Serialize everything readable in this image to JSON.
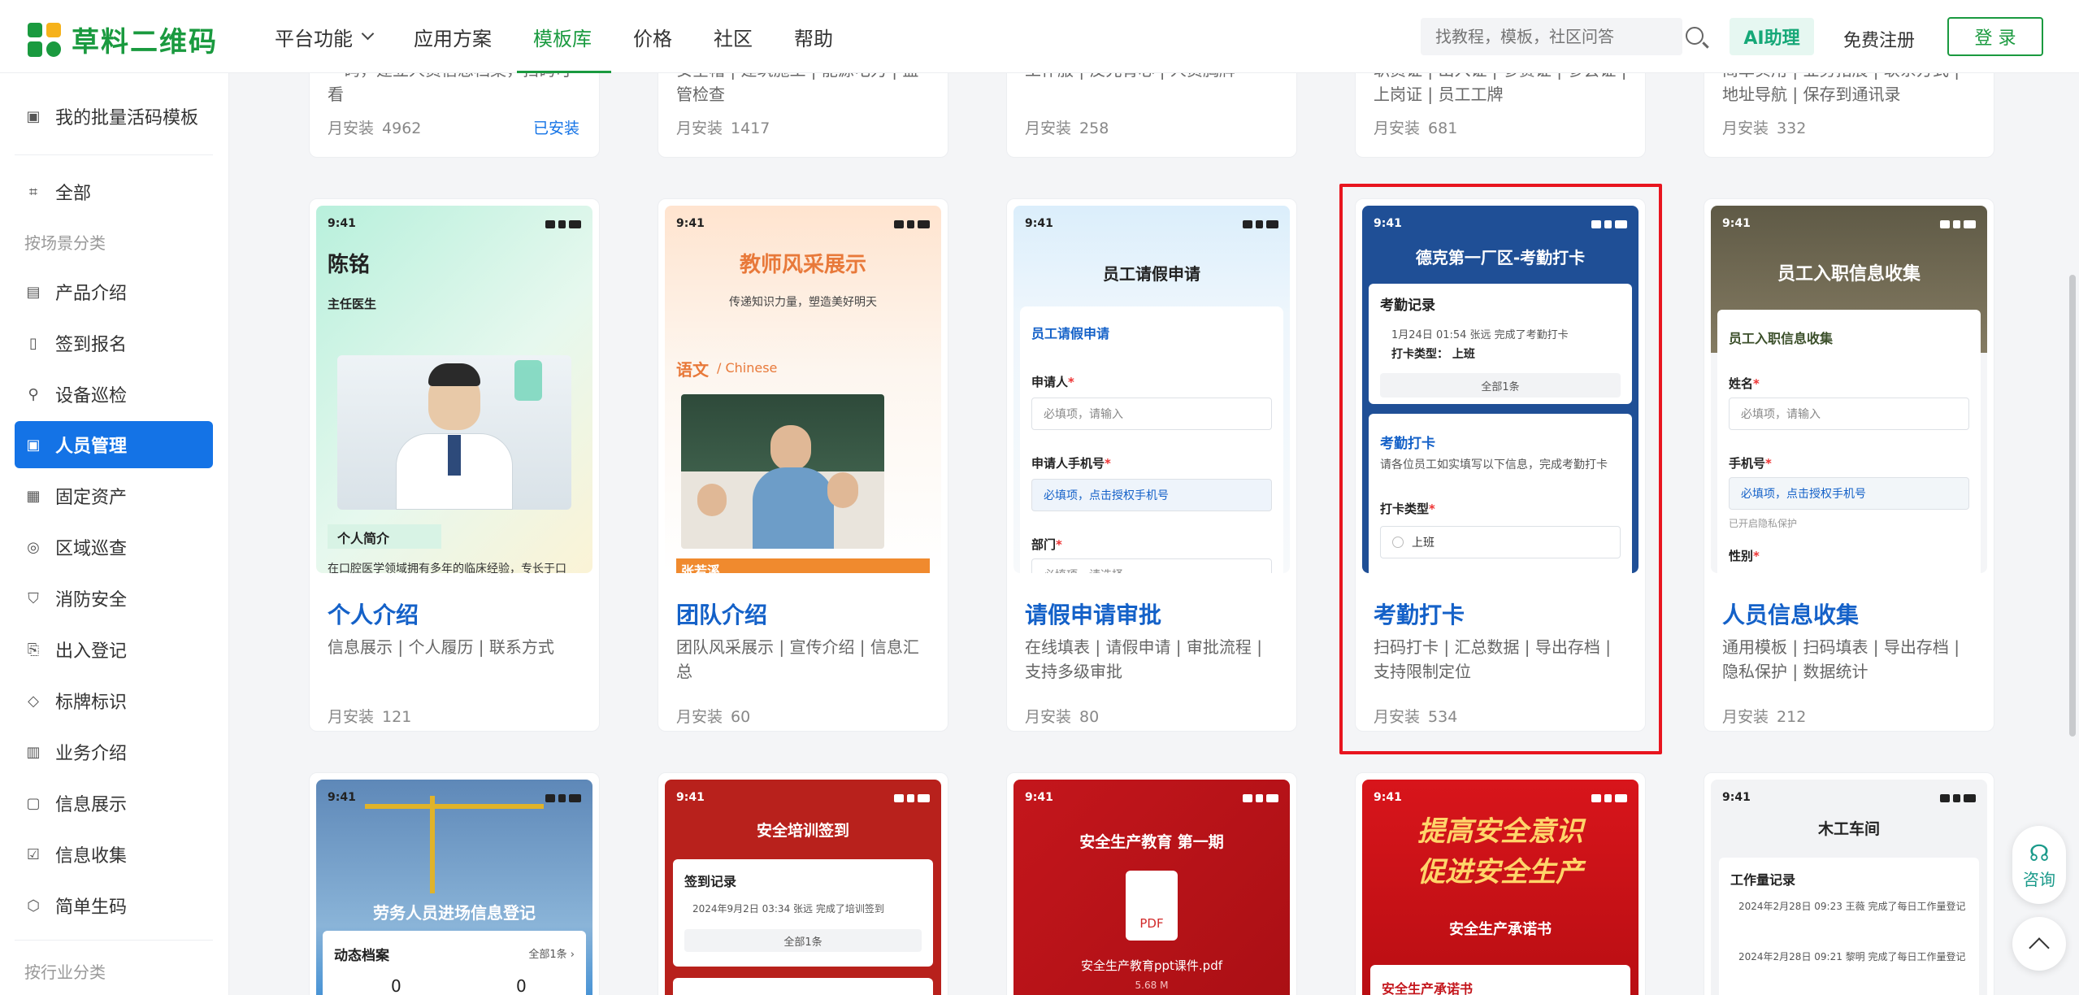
{
  "brand": {
    "name": "草料二维码",
    "colors": {
      "green": "#1a9a3f",
      "blue": "#1473e6",
      "highlight": "#e8151f"
    }
  },
  "nav": {
    "items": [
      {
        "label": "平台功能",
        "dropdown": true
      },
      {
        "label": "应用方案"
      },
      {
        "label": "模板库",
        "active": true
      },
      {
        "label": "价格"
      },
      {
        "label": "社区"
      },
      {
        "label": "帮助"
      }
    ]
  },
  "header": {
    "search_placeholder": "找教程，模板，社区问答",
    "ai_label": "AI助理",
    "register_label": "免费注册",
    "login_label": "登 录"
  },
  "sidebar": {
    "my_templates": "我的批量活码模板",
    "all": "全部",
    "scene_category": "按场景分类",
    "industry_category": "按行业分类",
    "items": [
      {
        "label": "产品介绍",
        "icon": "box-icon"
      },
      {
        "label": "签到报名",
        "icon": "signin-icon"
      },
      {
        "label": "设备巡检",
        "icon": "inspect-icon"
      },
      {
        "label": "人员管理",
        "icon": "person-icon",
        "active": true
      },
      {
        "label": "固定资产",
        "icon": "asset-icon"
      },
      {
        "label": "区域巡查",
        "icon": "location-icon"
      },
      {
        "label": "消防安全",
        "icon": "fire-icon"
      },
      {
        "label": "出入登记",
        "icon": "exit-icon"
      },
      {
        "label": "标牌标识",
        "icon": "tag-icon"
      },
      {
        "label": "业务介绍",
        "icon": "business-icon"
      },
      {
        "label": "信息展示",
        "icon": "display-icon"
      },
      {
        "label": "信息收集",
        "icon": "collect-icon"
      },
      {
        "label": "简单生码",
        "icon": "cube-icon"
      }
    ]
  },
  "top_cards": [
    {
      "tags": "一码，建立人员信息档案，扫码可看",
      "installs_label": "月安装",
      "installs": "4962",
      "status": "已安装"
    },
    {
      "tags": "安全帽 | 建筑施工 | 能源电力 | 监管检查",
      "installs_label": "月安装",
      "installs": "1417"
    },
    {
      "tags": "工作服 | 反光背心 | 人员胸牌",
      "installs_label": "月安装",
      "installs": "258"
    },
    {
      "tags": "职员证 | 出入证 | 参赛证 | 参会证 | 上岗证 | 员工工牌",
      "installs_label": "月安装",
      "installs": "681"
    },
    {
      "tags": "简单实用 | 业务拓展 | 联系方式 | 地址导航 | 保存到通讯录",
      "installs_label": "月安装",
      "installs": "332"
    }
  ],
  "cards": [
    {
      "title": "个人介绍",
      "tags": "信息展示 | 个人履历 | 联系方式",
      "installs_label": "月安装",
      "installs": "121",
      "preview": {
        "time": "9:41",
        "name": "陈铭",
        "role": "主任医生",
        "section": "个人简介",
        "desc": "在口腔医学领域拥有多年的临床经验，专长于口"
      }
    },
    {
      "title": "团队介绍",
      "tags": "团队风采展示 | 宣传介绍 | 信息汇总",
      "installs_label": "月安装",
      "installs": "60",
      "preview": {
        "time": "9:41",
        "heading": "教师风采展示",
        "sub": "传递知识力量，塑造美好明天",
        "subject": "语文",
        "subject_en": "/ Chinese",
        "teacher": "张若溪"
      }
    },
    {
      "title": "请假申请审批",
      "tags": "在线填表 | 请假申请 | 审批流程 | 支持多级审批",
      "installs_label": "月安装",
      "installs": "80",
      "preview": {
        "time": "9:41",
        "heading": "员工请假申请",
        "form_title": "员工请假申请",
        "f1": "申请人",
        "f1_ph": "必填项，请输入",
        "f2": "申请人手机号",
        "f2_ph": "必填项，点击授权手机号",
        "f3": "部门",
        "f3_ph": "必填项，请选择"
      }
    },
    {
      "title": "考勤打卡",
      "tags": "扫码打卡 | 汇总数据 | 导出存档 | 支持限制定位",
      "installs_label": "月安装",
      "installs": "534",
      "preview": {
        "time": "9:41",
        "heading": "德克第一厂区-考勤打卡",
        "rec_title": "考勤记录",
        "rec_line": "1月24日 01:54 张远 完成了考勤打卡",
        "rec_type": "打卡类型：  上班",
        "rec_all": "全部1条",
        "punch_title": "考勤打卡",
        "punch_desc": "请各位员工如实填写以下信息，完成考勤打卡",
        "punch_type": "打卡类型",
        "punch_opt": "上班"
      }
    },
    {
      "title": "人员信息收集",
      "tags": "通用模板 | 扫码填表 | 导出存档 | 隐私保护 | 数据统计",
      "installs_label": "月安装",
      "installs": "212",
      "preview": {
        "time": "9:41",
        "heading": "员工入职信息收集",
        "form_title": "员工入职信息收集",
        "f1": "姓名",
        "f1_ph": "必填项，请输入",
        "f2": "手机号",
        "f2_ph": "必填项，点击授权手机号",
        "f2_note": "已开启隐私保护",
        "f3": "性别"
      }
    }
  ],
  "bottom_cards": [
    {
      "time": "9:41",
      "heading": "劳务人员进场信息登记",
      "panel": "动态档案",
      "panel_link": "全部1条 ›",
      "n1": "0",
      "n2": "0"
    },
    {
      "time": "9:41",
      "heading": "安全培训签到",
      "rec": "签到记录",
      "line": "2024年9月2日 03:34 张远 完成了培训签到",
      "all": "全部1条"
    },
    {
      "time": "9:41",
      "heading": "安全生产教育 第一期",
      "file_badge": "PDF",
      "file": "安全生产教育ppt课件.pdf",
      "size": "5.68 M"
    },
    {
      "time": "9:41",
      "slogan1": "提高安全意识",
      "slogan2": "促进安全生产",
      "sub": "安全生产承诺书",
      "bottom_text": "安全生产承诺书"
    },
    {
      "time": "9:41",
      "heading": "木工车间",
      "rec": "工作量记录",
      "l1": "2024年2月28日 09:23 王薇 完成了每日工作量登记",
      "l2": "2024年2月28日 09:21 黎明 完成了每日工作量登记"
    }
  ],
  "float": {
    "consult": "咨询"
  }
}
